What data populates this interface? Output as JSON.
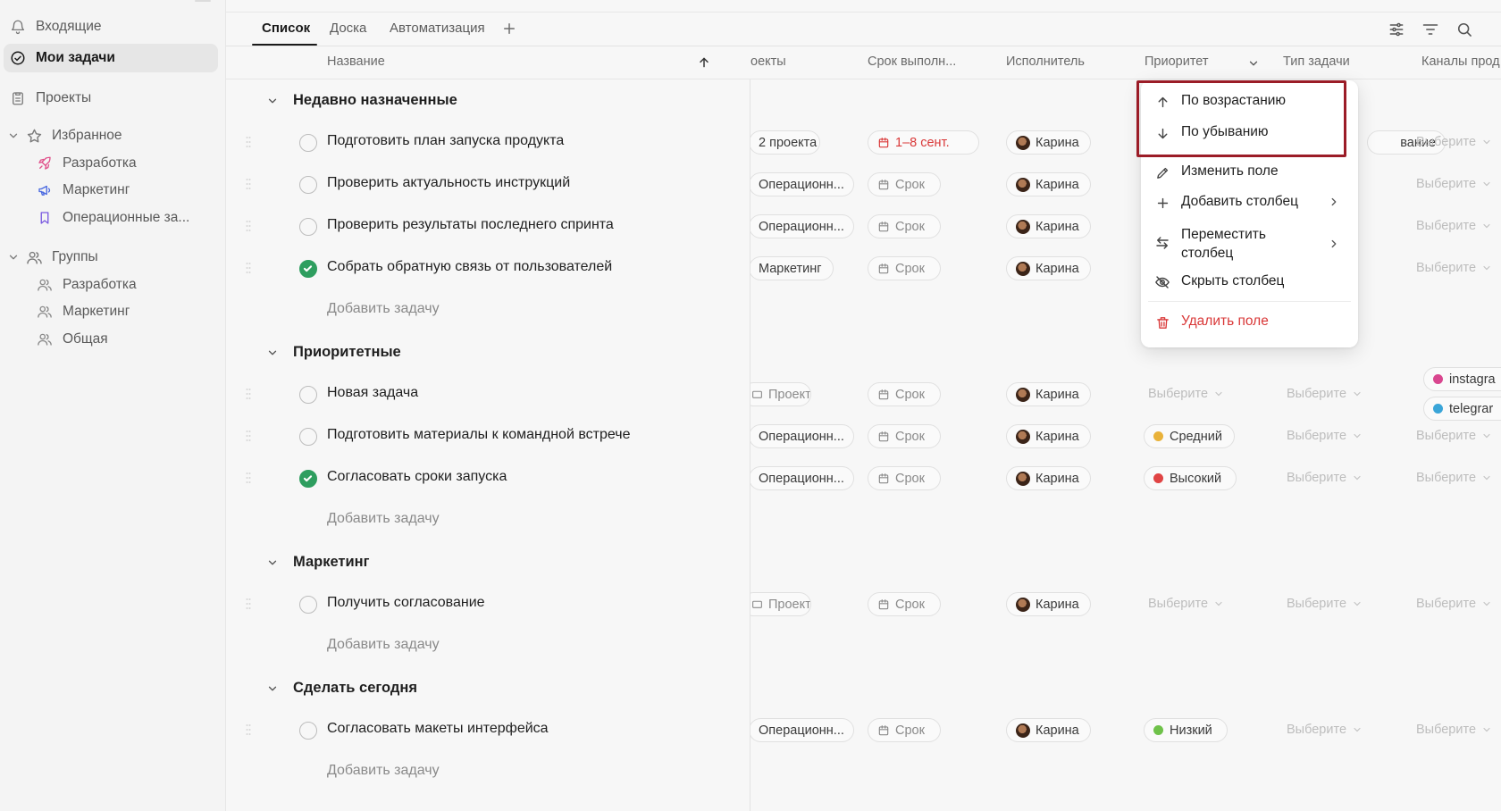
{
  "sidebar": {
    "inbox": "Входящие",
    "my_tasks": "Мои задачи",
    "projects": "Проекты",
    "favorites": {
      "label": "Избранное",
      "items": [
        "Разработка",
        "Маркетинг",
        "Операционные за..."
      ]
    },
    "groups": {
      "label": "Группы",
      "items": [
        "Разработка",
        "Маркетинг",
        "Общая"
      ]
    }
  },
  "tabs": [
    {
      "label": "Список",
      "active": true
    },
    {
      "label": "Доска",
      "active": false
    },
    {
      "label": "Автоматизация",
      "active": false
    }
  ],
  "columns": {
    "name": "Название",
    "projects": "оекты",
    "due": "Срок выполн...",
    "assignee": "Исполнитель",
    "priority": "Приоритет",
    "task_type": "Тип задачи",
    "channels": "Каналы прод"
  },
  "groups": [
    {
      "title": "Недавно назначенные",
      "add_label": "Добавить задачу",
      "tasks": [
        {
          "name": "Подготовить план запуска продукта",
          "done": false,
          "project": "2 проекта",
          "due": "1–8 сент.",
          "assignee": "Карина",
          "type_text": "вание"
        },
        {
          "name": "Проверить актуальность инструкций",
          "done": false,
          "project": "Операционн...",
          "due": "Срок",
          "assignee": "Карина"
        },
        {
          "name": "Проверить результаты последнего спринта",
          "done": false,
          "project": "Операционн...",
          "due": "Срок",
          "assignee": "Карина"
        },
        {
          "name": "Собрать обратную связь от пользователей",
          "done": true,
          "project": "Маркетинг",
          "due": "Срок",
          "assignee": "Карина"
        }
      ]
    },
    {
      "title": "Приоритетные",
      "add_label": "Добавить задачу",
      "tasks": [
        {
          "name": "Новая задача",
          "done": false,
          "project": "Проект",
          "due": "Срок",
          "assignee": "Карина",
          "priority": "Выберите",
          "type": "Выберите",
          "channels": [
            "instagra",
            "telegrar"
          ]
        },
        {
          "name": "Подготовить материалы к командной встрече",
          "done": false,
          "project": "Операционн...",
          "due": "Срок",
          "assignee": "Карина",
          "priority": "Средний",
          "type": "Выберите",
          "channel": "Выберите"
        },
        {
          "name": "Согласовать сроки запуска",
          "done": true,
          "project": "Операционн...",
          "due": "Срок",
          "assignee": "Карина",
          "priority": "Высокий",
          "type": "Выберите",
          "channel": "Выберите"
        }
      ]
    },
    {
      "title": "Маркетинг",
      "add_label": "Добавить задачу",
      "tasks": [
        {
          "name": "Получить согласование",
          "done": false,
          "project": "Проект",
          "due": "Срок",
          "assignee": "Карина",
          "priority": "Выберите",
          "type": "Выберите",
          "channel": "Выберите"
        }
      ]
    },
    {
      "title": "Сделать сегодня",
      "add_label": "Добавить задачу",
      "tasks": [
        {
          "name": "Согласовать макеты интерфейса",
          "done": false,
          "project": "Операционн...",
          "due": "Срок",
          "assignee": "Карина",
          "priority": "Низкий",
          "type": "Выберите",
          "channel": "Выберите"
        }
      ]
    }
  ],
  "select_placeholder": "Выберите",
  "menu": {
    "sort_asc": "По возрастанию",
    "sort_desc": "По убыванию",
    "edit_field": "Изменить поле",
    "add_column": "Добавить столбец",
    "move_column_line1": "Переместить",
    "move_column_line2": "столбец",
    "hide_column": "Скрыть столбец",
    "delete_field": "Удалить поле"
  },
  "colors": {
    "accent_dark": "#1a1a1a",
    "done_green": "#2e9e5f",
    "danger_red": "#d93838",
    "priority_medium": "#e9b23a",
    "priority_high": "#e04444",
    "priority_low": "#6fc24a",
    "channel_instagram": "#d9468f",
    "channel_telegram": "#3aa5d8",
    "highlight_border": "#9b1c27"
  }
}
